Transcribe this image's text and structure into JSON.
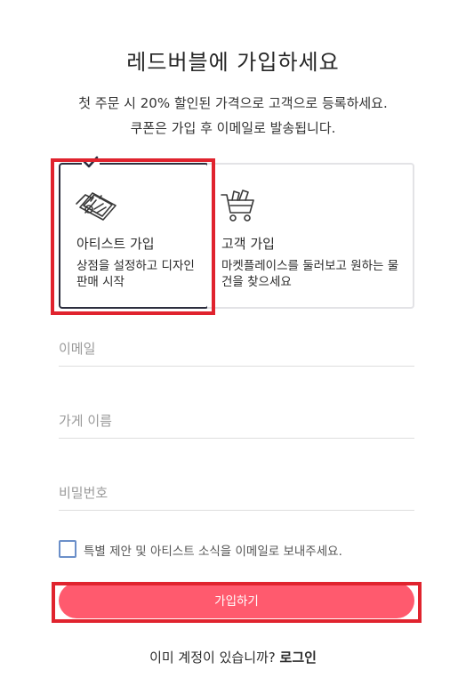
{
  "header": {
    "title": "레드버블에 가입하세요",
    "subtitle_line1": "첫 주문 시 20% 할인된 가격으로 고객으로 등록하세요.",
    "subtitle_line2": "쿠폰은 가입 후 이메일로 발송됩니다."
  },
  "account_types": [
    {
      "title": "아티스트 가입",
      "description": "상점을 설정하고 디자인 판매 시작",
      "icon": "artwork-icon",
      "selected": true
    },
    {
      "title": "고객 가입",
      "description": "마켓플레이스를 둘러보고 원하는 물건을 찾으세요",
      "icon": "shopping-cart-icon",
      "selected": false
    }
  ],
  "form": {
    "email_placeholder": "이메일",
    "shop_name_placeholder": "가게 이름",
    "password_placeholder": "비밀번호",
    "newsletter_label": "특별 제안 및 아티스트 소식을 이메일로 보내주세요.",
    "newsletter_checked": false,
    "submit_label": "가입하기"
  },
  "footer": {
    "have_account_text": "이미 계정이 있습니까? ",
    "login_label": "로그인"
  },
  "colors": {
    "accent": "#ff5a6e",
    "selected_border": "#2c2e3e",
    "highlight": "#e0232e",
    "checkbox_border": "#6b8fc9"
  }
}
